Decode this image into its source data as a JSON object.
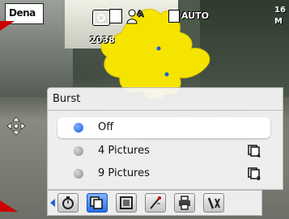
{
  "osd": {
    "mode_badge": "Dena",
    "count": "2038",
    "auto": "AUTO",
    "top_right": [
      "16",
      "M"
    ]
  },
  "menu": {
    "title": "Burst",
    "options": [
      {
        "label": "Off",
        "selected": true,
        "icon": "none"
      },
      {
        "label": "4 Pictures",
        "selected": false,
        "icon": "burst-4-icon"
      },
      {
        "label": "9 Pictures",
        "selected": false,
        "icon": "burst-9-icon"
      }
    ]
  },
  "toolbar": {
    "tools": [
      "self-timer-icon",
      "burst-icon",
      "frame-icon",
      "wand-icon",
      "print-icon",
      "tools-icon"
    ],
    "active_index": 1
  },
  "colors": {
    "accent": "#1a5fe0",
    "flower": "#f5e400",
    "corner": "#cc0000"
  }
}
